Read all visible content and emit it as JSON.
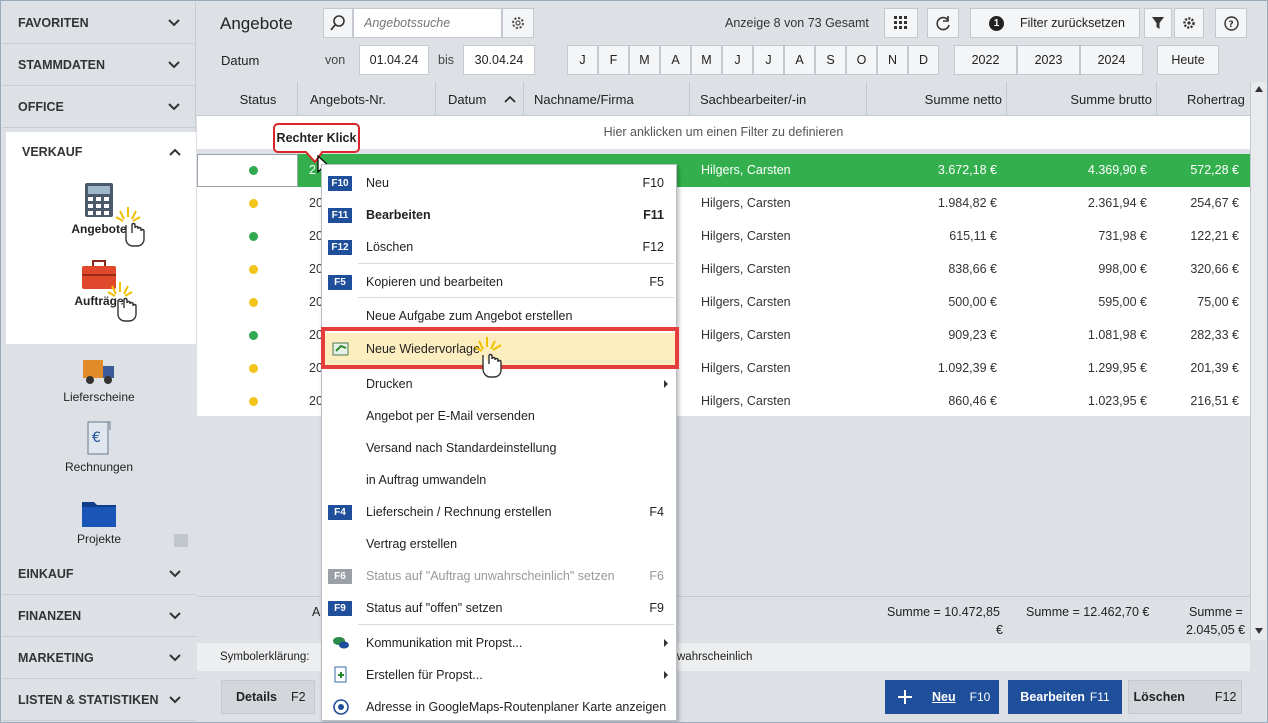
{
  "sidebar": {
    "sections_top": [
      "FAVORITEN",
      "STAMMDATEN",
      "OFFICE"
    ],
    "active_section": "VERKAUF",
    "items": [
      {
        "label": "Angebote",
        "icon": "calculator-icon"
      },
      {
        "label": "Aufträge",
        "icon": "toolbox-icon"
      },
      {
        "label": "Lieferscheine",
        "icon": "truck-icon"
      },
      {
        "label": "Rechnungen",
        "icon": "invoice-icon"
      },
      {
        "label": "Projekte",
        "icon": "folder-icon"
      }
    ],
    "sections_bottom": [
      "EINKAUF",
      "FINANZEN",
      "MARKETING",
      "LISTEN & STATISTIKEN"
    ]
  },
  "header": {
    "title": "Angebote",
    "search_placeholder": "Angebotssuche",
    "count_text": "Anzeige 8 von 73 Gesamt",
    "filter_reset_label": "Filter zurücksetzen",
    "filter_badge": "1"
  },
  "datefilter": {
    "label": "Datum",
    "from_label": "von",
    "from_value": "01.04.24",
    "to_label": "bis",
    "to_value": "30.04.24",
    "months": [
      "J",
      "F",
      "M",
      "A",
      "M",
      "J",
      "J",
      "A",
      "S",
      "O",
      "N",
      "D"
    ],
    "years": [
      "2022",
      "2023",
      "2024"
    ],
    "today_label": "Heute"
  },
  "grid": {
    "columns": [
      "Status",
      "Angebots-Nr.",
      "Datum",
      "Nachname/Firma",
      "Sachbearbeiter/-in",
      "Summe netto",
      "Summe brutto",
      "Rohertrag"
    ],
    "filter_hint": "Hier anklicken um einen Filter zu definieren",
    "rows": [
      {
        "status": "green",
        "nr": "2",
        "agent": "Hilgers, Carsten",
        "netto": "3.672,18 €",
        "brutto": "4.369,90 €",
        "roh": "572,28 €"
      },
      {
        "status": "yellow",
        "nr": "20",
        "agent": "Hilgers, Carsten",
        "netto": "1.984,82 €",
        "brutto": "2.361,94 €",
        "roh": "254,67 €"
      },
      {
        "status": "green",
        "nr": "20",
        "agent": "Hilgers, Carsten",
        "netto": "615,11 €",
        "brutto": "731,98 €",
        "roh": "122,21 €"
      },
      {
        "status": "yellow",
        "nr": "20",
        "agent": "Hilgers, Carsten",
        "netto": "838,66 €",
        "brutto": "998,00 €",
        "roh": "320,66 €"
      },
      {
        "status": "yellow",
        "nr": "20",
        "agent": "Hilgers, Carsten",
        "netto": "500,00 €",
        "brutto": "595,00 €",
        "roh": "75,00 €"
      },
      {
        "status": "green",
        "nr": "20",
        "agent": "Hilgers, Carsten",
        "netto": "909,23 €",
        "brutto": "1.081,98 €",
        "roh": "282,33 €"
      },
      {
        "status": "yellow",
        "nr": "20",
        "agent": "Hilgers, Carsten",
        "netto": "1.092,39 €",
        "brutto": "1.299,95 €",
        "roh": "201,39 €"
      },
      {
        "status": "yellow",
        "nr": "20",
        "agent": "Hilgers, Carsten",
        "netto": "860,46 €",
        "brutto": "1.023,95 €",
        "roh": "216,51 €"
      }
    ],
    "sums": {
      "left": "A",
      "netto_line1": "Summe = 10.472,85",
      "netto_line2": "€",
      "brutto": "Summe = 12.462,70 €",
      "roh_line1": "Summe =",
      "roh_line2": "2.045,05 €"
    },
    "legend_label": "Symbolerklärung:",
    "legend_tail": "wahrscheinlich"
  },
  "footer": {
    "details": "Details",
    "details_key": "F2",
    "new": "Neu",
    "new_key": "F10",
    "edit": "Bearbeiten",
    "edit_key": "F11",
    "delete": "Löschen",
    "delete_key": "F12"
  },
  "callout": "Rechter Klick",
  "menu": [
    {
      "key": "F10",
      "label": "Neu",
      "shortcut": "F10"
    },
    {
      "key": "F11",
      "label": "Bearbeiten",
      "shortcut": "F11",
      "bold": true
    },
    {
      "key": "F12",
      "label": "Löschen",
      "shortcut": "F12"
    },
    {
      "key": "F5",
      "label": "Kopieren und bearbeiten",
      "shortcut": "F5"
    },
    {
      "label": "Neue Aufgabe zum Angebot erstellen"
    },
    {
      "label": "Neue Wiedervorlage",
      "icon": "wiedervorlage-icon",
      "highlight": true
    },
    {
      "label": "Drucken",
      "submenu": true
    },
    {
      "label": "Angebot per E-Mail versenden"
    },
    {
      "label": "Versand nach Standardeinstellung"
    },
    {
      "label": "in Auftrag umwandeln"
    },
    {
      "key": "F4",
      "label": "Lieferschein / Rechnung erstellen",
      "shortcut": "F4"
    },
    {
      "label": "Vertrag erstellen"
    },
    {
      "key": "F6",
      "label": "Status auf \"Auftrag unwahrscheinlich\" setzen",
      "shortcut": "F6",
      "disabled": true
    },
    {
      "key": "F9",
      "label": "Status auf \"offen\" setzen",
      "shortcut": "F9"
    },
    {
      "label": "Kommunikation mit Propst...",
      "icon": "chat-icon",
      "submenu": true
    },
    {
      "label": "Erstellen für Propst...",
      "icon": "new-doc-icon",
      "submenu": true
    },
    {
      "label": "Adresse in GoogleMaps-Routenplaner Karte anzeigen",
      "icon": "target-icon"
    }
  ],
  "colors": {
    "selected_row": "#33b04d",
    "status_green": "#2fa84f",
    "status_yellow": "#f2c318",
    "key_badge": "#1f4e9a",
    "highlight_border": "#e53c3c",
    "highlight_fill": "#fdeec0",
    "primary_button": "#1f4e9a"
  }
}
